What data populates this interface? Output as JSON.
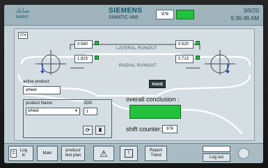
{
  "header": {
    "logo_arabic": "سابك",
    "logo_text": "SABIC",
    "brand": "SIEMENS",
    "product": "SIMATIC HMI",
    "counter_value": "976",
    "date": "3/9/20",
    "time": "9:36:46 AM"
  },
  "panel": {
    "tag": "274",
    "lateral_left": "0.560",
    "lateral_right": "0.520",
    "lateral_label": "LATERAL RUNOUT",
    "radial_left": "1.823",
    "radial_right": "0.713",
    "radial_label": "RADIAL RUNOUT",
    "trend_label": "trend",
    "active_product_label": "active product:",
    "active_product_value": "wheel",
    "product_name_label": "product Name:",
    "product_name_value": "wheel",
    "sdk_label": "SDK:",
    "sdk_value": "1",
    "overall_label": "overall conclusion :",
    "shift_label": "shift counter:",
    "shift_value": "976"
  },
  "footer": {
    "login": "Log in",
    "main": "Main",
    "product_test_plan": "product/ test plan",
    "report_trend": "Report Trend",
    "logout": "Log out"
  },
  "colors": {
    "status_ok": "#23c23e",
    "screen_bg": "#c4d1d6",
    "header_bg": "#9fb3bd"
  }
}
